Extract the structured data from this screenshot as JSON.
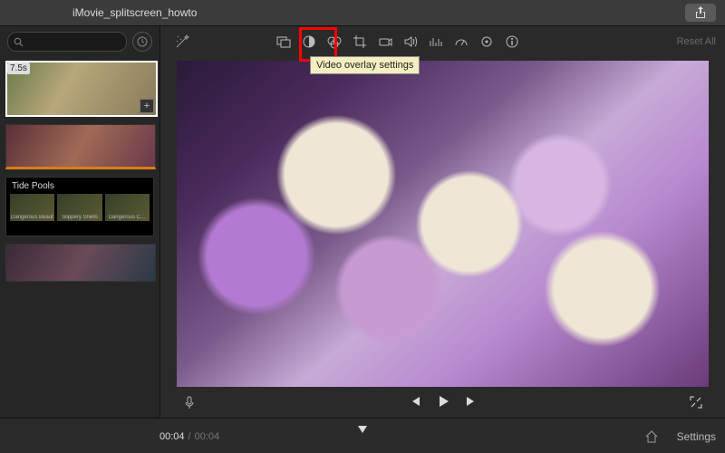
{
  "window": {
    "title": "iMovie_splitscreen_howto"
  },
  "sidebar": {
    "search_placeholder": "",
    "clip_duration": "7.5s",
    "titlecard_label": "Tide Pools",
    "titlecard_items": [
      "Dangerous Beauty Anemone",
      "Slippery Shells",
      "Dangerous C…"
    ]
  },
  "toolbar": {
    "icons": [
      "magic-wand",
      "overlay",
      "color-balance",
      "color-correct",
      "crop",
      "stabilize",
      "volume",
      "eq",
      "speed",
      "noise",
      "info"
    ],
    "tooltip": "Video overlay settings",
    "reset_label": "Reset All"
  },
  "playback": {
    "current": "00:04",
    "total": "00:04"
  },
  "footer": {
    "settings_label": "Settings"
  }
}
